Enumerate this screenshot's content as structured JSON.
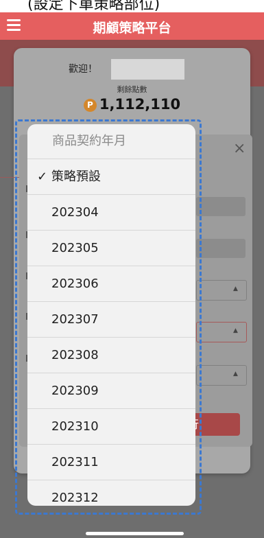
{
  "statusbar": {
    "text": "(設定下單策略部位)"
  },
  "header": {
    "title": "期顧策略平台"
  },
  "account": {
    "welcome": "歡迎！",
    "points_label": "剩餘點數",
    "points_coin": "P",
    "points_value": "1,112,110"
  },
  "modal": {
    "close_symbol": "×",
    "submit_partial": "行"
  },
  "picker": {
    "title": "商品契約年月",
    "check_symbol": "✓",
    "options": [
      {
        "label": "策略預設",
        "selected": true
      },
      {
        "label": "202304"
      },
      {
        "label": "202305"
      },
      {
        "label": "202306"
      },
      {
        "label": "202307"
      },
      {
        "label": "202308"
      },
      {
        "label": "202309"
      },
      {
        "label": "202310"
      },
      {
        "label": "202311"
      },
      {
        "label": "202312"
      }
    ]
  },
  "colors": {
    "header": "#e55f5f",
    "highlight_frame": "#3b78d1"
  }
}
